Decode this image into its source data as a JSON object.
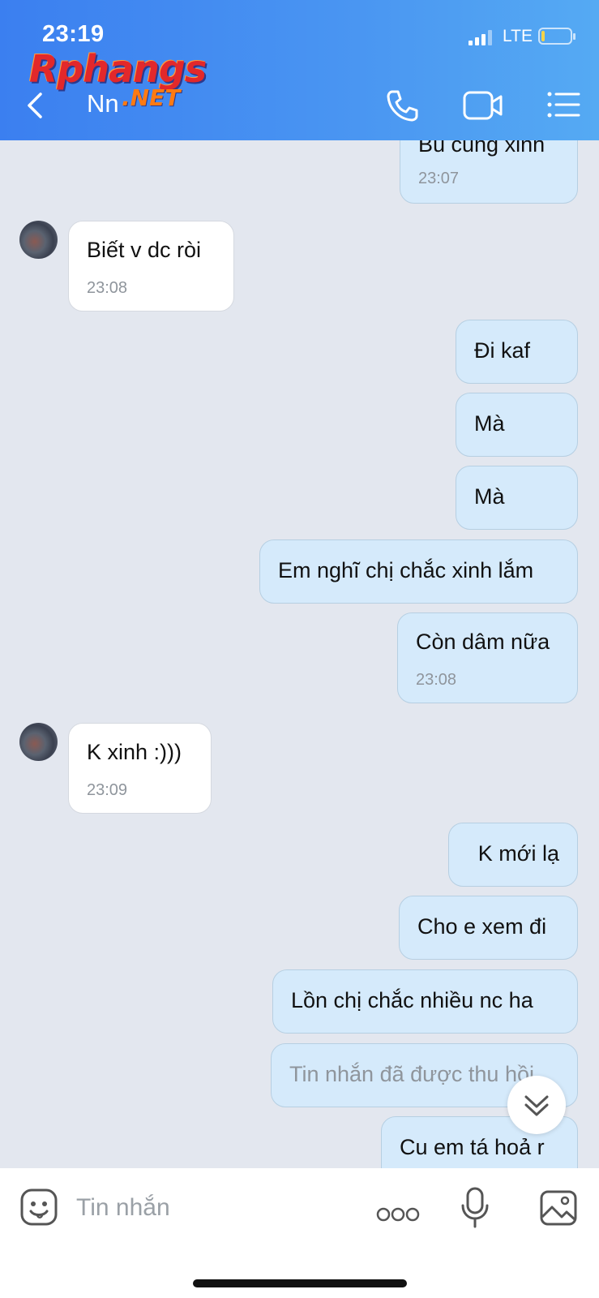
{
  "status_bar": {
    "time": "23:19",
    "network": "LTE"
  },
  "watermark": {
    "brand": "Rphangs",
    "suffix": ".NET"
  },
  "header": {
    "contact_name": "Nn"
  },
  "messages": [
    {
      "dir": "sent",
      "text": "Bù cũng xinh",
      "time": "23:07"
    },
    {
      "dir": "recv",
      "text": "Biết v dc ròi",
      "time": "23:08"
    },
    {
      "dir": "sent",
      "text": "Đi kaf"
    },
    {
      "dir": "sent",
      "text": "Mà"
    },
    {
      "dir": "sent",
      "text": "Mà"
    },
    {
      "dir": "sent",
      "text": "Em nghĩ chị chắc xinh lắm"
    },
    {
      "dir": "sent",
      "text": "Còn dâm nữa",
      "time": "23:08"
    },
    {
      "dir": "recv",
      "text": "K xinh :)))",
      "time": "23:09"
    },
    {
      "dir": "sent",
      "text": "K mới lạ"
    },
    {
      "dir": "sent",
      "text": "Cho e xem đi"
    },
    {
      "dir": "sent",
      "text": "Lồn chị chắc nhiều nc ha"
    },
    {
      "dir": "sent",
      "text": "Tin nhắn đã được thu hồi",
      "recalled": true
    },
    {
      "dir": "sent",
      "text": "Cu em tá hoả r"
    }
  ],
  "composer": {
    "placeholder": "Tin nhắn"
  },
  "colors": {
    "header_start": "#3b7ff0",
    "header_end": "#55aaf3",
    "sent_bubble": "#d5eafb",
    "chat_bg": "#e3e7ef"
  },
  "icons": [
    "back-icon",
    "phone-icon",
    "video-call-icon",
    "menu-list-icon",
    "sticker-icon",
    "more-icon",
    "microphone-icon",
    "image-icon",
    "scroll-down-icon"
  ]
}
